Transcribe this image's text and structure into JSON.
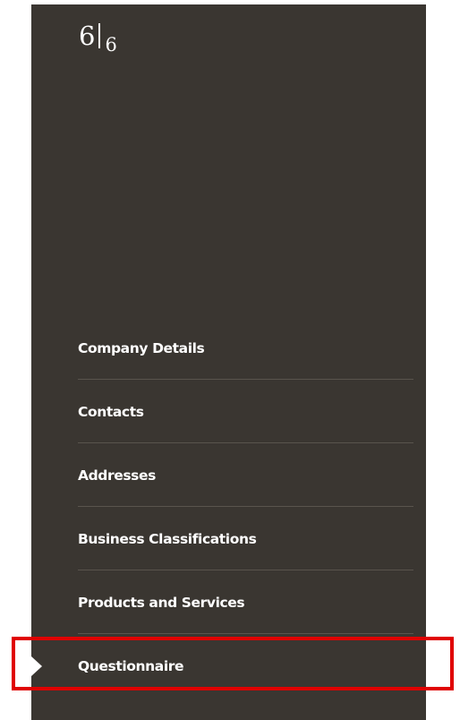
{
  "progress": {
    "current": "6",
    "total": "6"
  },
  "nav": {
    "items": [
      {
        "label": "Company Details"
      },
      {
        "label": "Contacts"
      },
      {
        "label": "Addresses"
      },
      {
        "label": "Business Classifications"
      },
      {
        "label": "Products and Services"
      },
      {
        "label": "Questionnaire",
        "selected": true
      }
    ]
  },
  "colors": {
    "panel_bg": "#3a3631",
    "text": "#ffffff",
    "divider": "#59544d",
    "highlight_border": "#e00000"
  }
}
